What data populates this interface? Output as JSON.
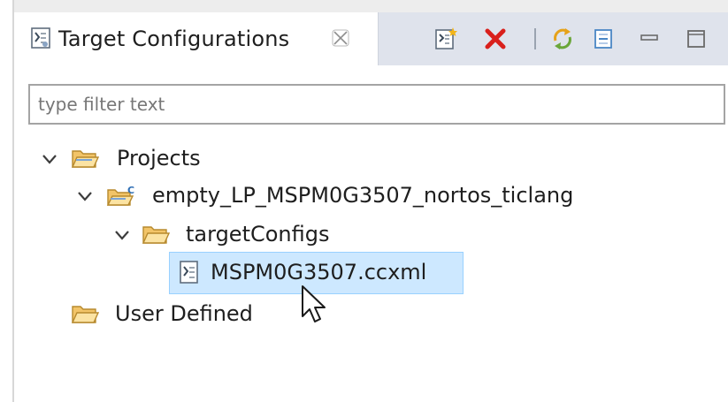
{
  "view": {
    "tab_title": "Target Configurations",
    "tab_icon": "target-config-icon",
    "close_icon": "close-tab-icon"
  },
  "toolbar": {
    "icons": [
      "new-target-config-icon",
      "delete-icon",
      "refresh-icon",
      "collapse-all-icon",
      "minimize-icon",
      "maximize-icon"
    ]
  },
  "filter": {
    "placeholder": "type filter text",
    "value": ""
  },
  "tree": {
    "projects": "Projects",
    "project_name": "empty_LP_MSPM0G3507_nortos_ticlang",
    "target_configs": "targetConfigs",
    "ccxml_file": "MSPM0G3507.ccxml",
    "user_defined": "User Defined"
  },
  "colors": {
    "selection": "#cde8ff",
    "tab_strip": "#dfe3ec",
    "folder": "#f2c468",
    "delete": "#d9201c"
  }
}
